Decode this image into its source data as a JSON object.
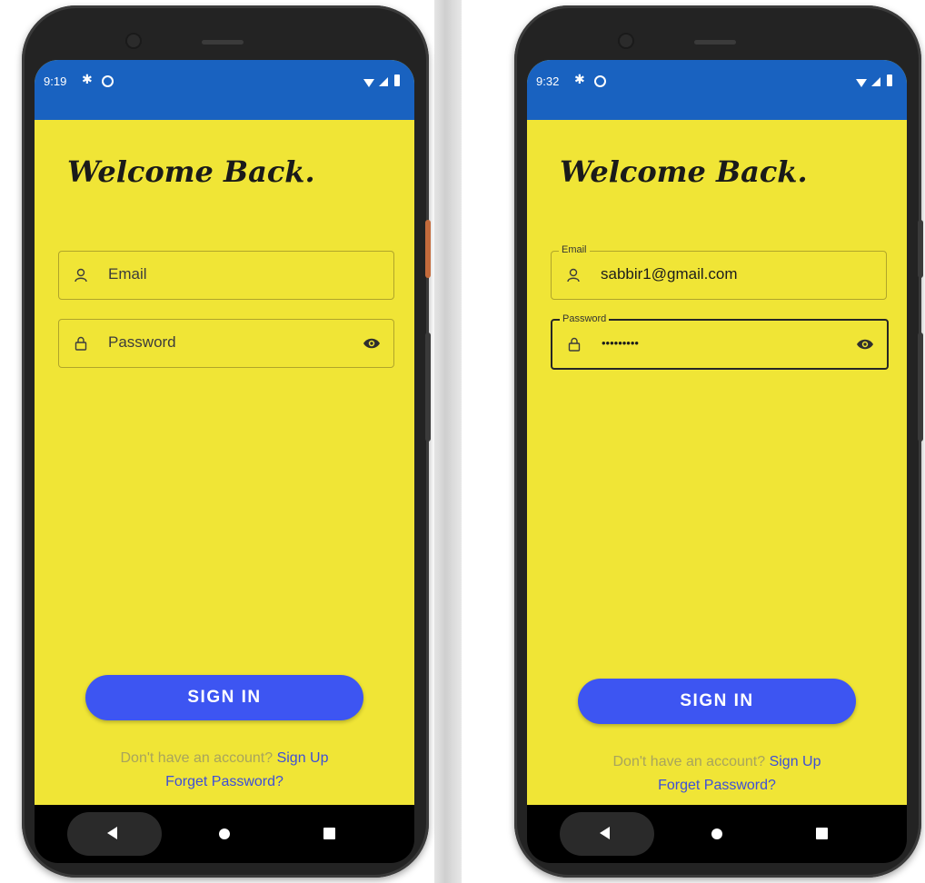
{
  "phones": [
    {
      "status_time": "9:19",
      "title": "Welcome Back.",
      "email": {
        "label": "Email",
        "placeholder": "Email",
        "value": ""
      },
      "password": {
        "label": "Password",
        "placeholder": "Password",
        "value": ""
      },
      "signin_label": "SIGN IN",
      "no_account_text": "Don't have an account?",
      "signup_link": "Sign Up",
      "forget_link": "Forget Password?"
    },
    {
      "status_time": "9:32",
      "title": "Welcome Back.",
      "email": {
        "label": "Email",
        "placeholder": "Email",
        "value": "sabbir1@gmail.com"
      },
      "password": {
        "label": "Password",
        "placeholder": "Password",
        "value": "•••••••••"
      },
      "signin_label": "SIGN IN",
      "no_account_text": "Don't have an account?",
      "signup_link": "Sign Up",
      "forget_link": "Forget Password?"
    }
  ],
  "icons": [
    "settings-gear-icon",
    "do-not-disturb-icon",
    "wifi-icon",
    "cell-signal-icon",
    "battery-icon",
    "person-icon",
    "lock-icon",
    "eye-icon",
    "nav-back-icon",
    "nav-home-icon",
    "nav-recent-icon"
  ],
  "colors": {
    "screen_bg": "#f0e536",
    "status_bar": "#1962c0",
    "button": "#3d55f2",
    "link": "#3d4fd8",
    "muted_text": "#a8a45c"
  }
}
